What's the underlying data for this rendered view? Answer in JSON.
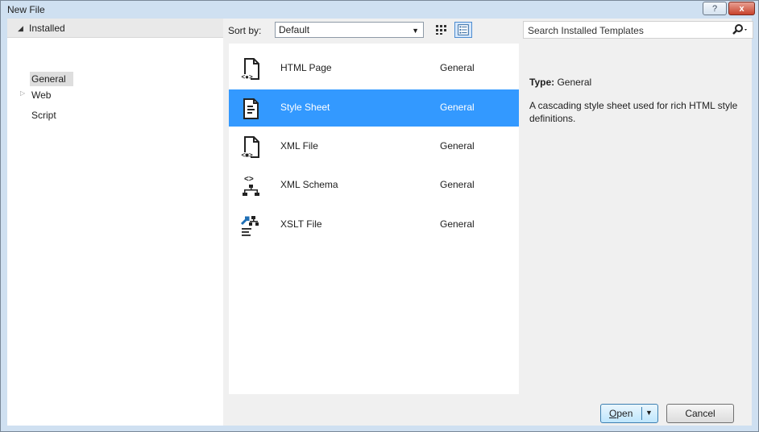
{
  "window": {
    "title": "New File",
    "help_glyph": "?",
    "close_glyph": "x"
  },
  "categories": {
    "header": "Installed",
    "items": [
      "General",
      "Web",
      "Script"
    ]
  },
  "sortbar": {
    "label": "Sort by:",
    "value": "Default"
  },
  "templates": [
    {
      "name": "HTML Page",
      "category": "General",
      "icon": "html-page-icon"
    },
    {
      "name": "Style Sheet",
      "category": "General",
      "icon": "style-sheet-icon"
    },
    {
      "name": "XML File",
      "category": "General",
      "icon": "xml-file-icon"
    },
    {
      "name": "XML Schema",
      "category": "General",
      "icon": "xml-schema-icon"
    },
    {
      "name": "XSLT File",
      "category": "General",
      "icon": "xslt-file-icon"
    }
  ],
  "search": {
    "placeholder": "Search Installed Templates"
  },
  "details": {
    "type_label": "Type:",
    "type_value": "General",
    "description": "A cascading style sheet used for rich HTML style definitions."
  },
  "buttons": {
    "open": "Open",
    "cancel": "Cancel"
  },
  "colors": {
    "selection": "#3399ff",
    "frame": "#cfe0f1"
  }
}
